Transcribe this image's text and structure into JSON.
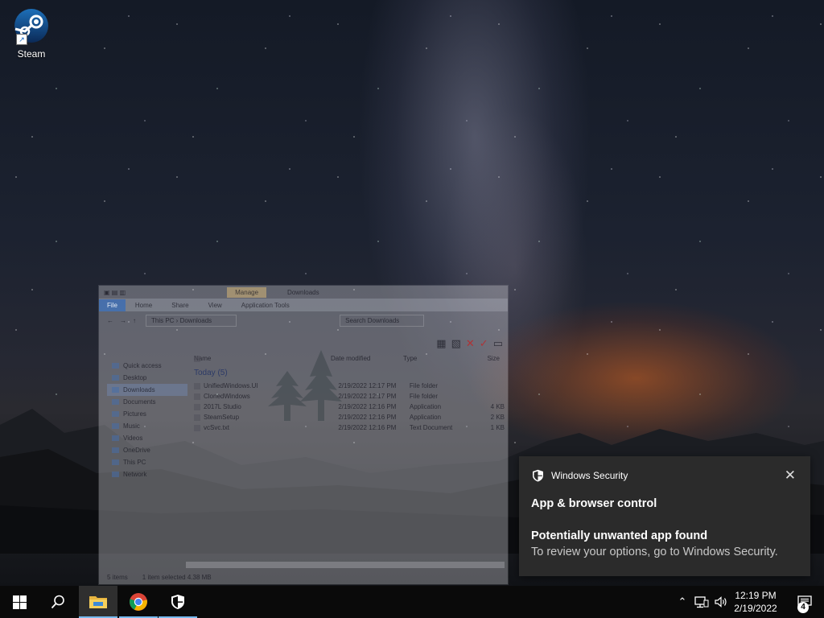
{
  "desktop": {
    "icons": [
      {
        "label": "Steam",
        "icon": "steam-icon"
      }
    ]
  },
  "explorer": {
    "title": "Downloads",
    "contextual_tab": "Manage",
    "ribbon_tabs": [
      "File",
      "Home",
      "Share",
      "View",
      "Application Tools"
    ],
    "address": [
      "This PC",
      "Downloads"
    ],
    "search_placeholder": "Search Downloads",
    "nav_items": [
      "Quick access",
      "Desktop",
      "Downloads",
      "Documents",
      "Pictures",
      "Music",
      "Videos",
      "OneDrive",
      "This PC",
      "Network"
    ],
    "selected_nav": "Downloads",
    "column_headers": [
      "Name",
      "Date modified",
      "Type",
      "Size"
    ],
    "group_label": "Today (5)",
    "files": [
      {
        "name": "UnifiedWindows.UI",
        "date": "2/19/2022 12:17 PM",
        "type": "File folder",
        "size": ""
      },
      {
        "name": "ClonedWindows",
        "date": "2/19/2022 12:17 PM",
        "type": "File folder",
        "size": ""
      },
      {
        "name": "2017L Studio",
        "date": "2/19/2022 12:16 PM",
        "type": "Application",
        "size": "4 KB"
      },
      {
        "name": "SteamSetup",
        "date": "2/19/2022 12:16 PM",
        "type": "Application",
        "size": "2 KB"
      },
      {
        "name": "vcSvc.txt",
        "date": "2/19/2022 12:16 PM",
        "type": "Text Document",
        "size": "1 KB"
      }
    ],
    "status_items": "5 items",
    "status_selected": "1 item selected  4.38 MB"
  },
  "toast": {
    "app_name": "Windows Security",
    "heading": "App & browser control",
    "title": "Potentially unwanted app found",
    "body": "To review your options, go to Windows Security.",
    "close_glyph": "✕"
  },
  "taskbar": {
    "apps": [
      {
        "name": "File Explorer",
        "icon": "folder-icon",
        "state": "active"
      },
      {
        "name": "Google Chrome",
        "icon": "chrome-icon",
        "state": "running"
      },
      {
        "name": "Windows Security",
        "icon": "shield-icon",
        "state": "running"
      }
    ],
    "clock_time": "12:19 PM",
    "clock_date": "2/19/2022",
    "notification_count": "4"
  },
  "colors": {
    "taskbar_bg": "#0a0a0a",
    "toast_bg": "#2b2b2b",
    "accent": "#76b9ed",
    "win_blue": "#1e90ff"
  }
}
